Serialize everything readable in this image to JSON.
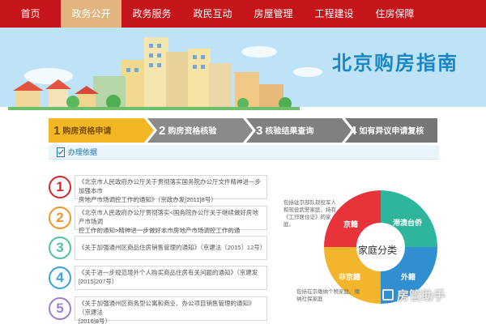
{
  "nav": {
    "items": [
      {
        "label": "首页",
        "active": false
      },
      {
        "label": "政务公开",
        "active": true
      },
      {
        "label": "政务服务",
        "active": false
      },
      {
        "label": "政民互动",
        "active": false
      },
      {
        "label": "房屋管理",
        "active": false
      },
      {
        "label": "工程建设",
        "active": false
      },
      {
        "label": "住房保障",
        "active": false
      }
    ]
  },
  "hero": {
    "title": "北京购房指南"
  },
  "steps": [
    {
      "num": "1",
      "label": "购房资格申请",
      "active": true
    },
    {
      "num": "2",
      "label": "购房资格核验",
      "active": false
    },
    {
      "num": "3",
      "label": "核验结果查询",
      "active": false
    },
    {
      "num": "4",
      "label": "如有异议申请复核",
      "active": false
    }
  ],
  "sub_header": {
    "label": "办理依据"
  },
  "list": [
    {
      "num": "1",
      "color": "#d7262e",
      "line1": "《北京市人民政府办公厅关于贯彻落实国务院办公厅文件精神进一步加强本市",
      "line2": "房地产市场调控工作的通知》（京政办发[2011]8号）"
    },
    {
      "num": "2",
      "color": "#f0962a",
      "line1": "《北京市人民政府办公厅贯彻落实<国务院办公厅关于继续做好房地产市场调",
      "line2": "控工作的通知>精神进一步做好本市房地产市场调控工作的通知》……"
    },
    {
      "num": "3",
      "color": "#4cc3a2",
      "line1": "《关于加强通州区商品住房销售管理的通知》（京建法〔2015〕12号）",
      "line2": ""
    },
    {
      "num": "4",
      "color": "#37a3dc",
      "line1": "《关于进一步规范境外个人购买商品住房有关问题的通知》（京建发",
      "line2": "[2015]207号）"
    },
    {
      "num": "5",
      "color": "#9b7fd1",
      "line1": "《关于加强通州区商务型公寓和商业、办公项目销售管理的通知》（京建法",
      "line2": "[2016]8号）"
    }
  ],
  "ring": {
    "center": "家庭分类",
    "segments": [
      {
        "label": "京籍",
        "color": "#e8333a"
      },
      {
        "label": "港澳台侨",
        "color": "#2eb59b"
      },
      {
        "label": "外籍",
        "color": "#2f8fd0"
      },
      {
        "label": "非京籍",
        "color": "#f2b52b"
      }
    ],
    "note_top": "包括驻京部队现役军人和现役武警家庭、持有《工作居住证》的家庭。",
    "note_bottom": "包括在京缴纳个税家庭、缴纳社保家庭"
  },
  "watermark": {
    "label": "房管助手"
  }
}
